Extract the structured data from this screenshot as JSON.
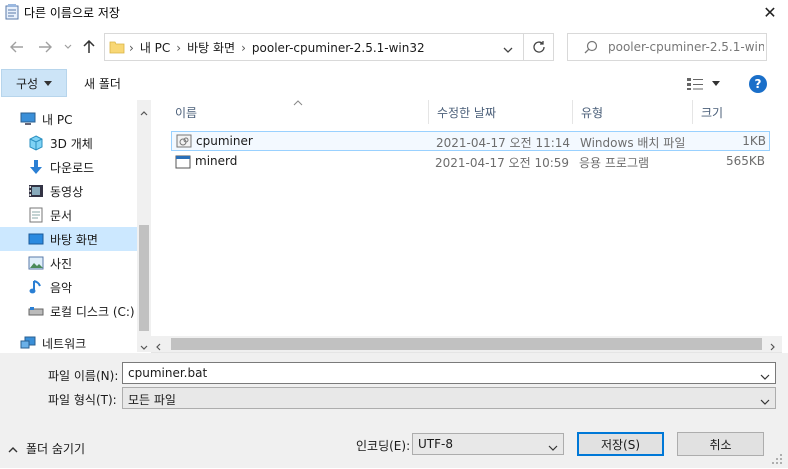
{
  "window": {
    "title": "다른 이름으로 저장",
    "close_icon": "✕"
  },
  "address": {
    "segments": [
      "내 PC",
      "바탕 화면",
      "pooler-cpuminer-2.5.1-win32"
    ],
    "separator": "›"
  },
  "search": {
    "placeholder": "pooler-cpuminer-2.5.1-win..."
  },
  "toolbar": {
    "organize_label": "구성",
    "new_folder_label": "새 폴더"
  },
  "sidebar": {
    "items": [
      {
        "label": "내 PC",
        "icon": "pc-icon"
      },
      {
        "label": "3D 개체",
        "icon": "cube-icon"
      },
      {
        "label": "다운로드",
        "icon": "download-icon"
      },
      {
        "label": "동영상",
        "icon": "video-icon"
      },
      {
        "label": "문서",
        "icon": "document-icon"
      },
      {
        "label": "바탕 화면",
        "icon": "desktop-icon",
        "selected": true
      },
      {
        "label": "사진",
        "icon": "picture-icon"
      },
      {
        "label": "음악",
        "icon": "music-icon"
      },
      {
        "label": "로컬 디스크 (C:)",
        "icon": "drive-icon"
      },
      {
        "label": "네트워크",
        "icon": "network-icon"
      }
    ]
  },
  "columns": {
    "name": "이름",
    "date": "수정한 날짜",
    "type": "유형",
    "size": "크기"
  },
  "files": [
    {
      "name": "cpuminer",
      "date": "2021-04-17 오전 11:14",
      "type": "Windows 배치 파일",
      "size": "1KB"
    },
    {
      "name": "minerd",
      "date": "2021-04-17 오전 10:59",
      "type": "응용 프로그램",
      "size": "565KB"
    }
  ],
  "form": {
    "filename_label": "파일 이름(N):",
    "filename_value": "cpuminer.bat",
    "filetype_label": "파일 형식(T):",
    "filetype_value": "모든 파일",
    "encoding_label": "인코딩(E):",
    "encoding_value": "UTF-8"
  },
  "footer": {
    "hide_folders_label": "폴더 숨기기",
    "save_label": "저장(S)",
    "cancel_label": "취소"
  },
  "colors": {
    "accent": "#0078d7",
    "selected": "#cce8ff",
    "header_text": "#4c607a"
  }
}
